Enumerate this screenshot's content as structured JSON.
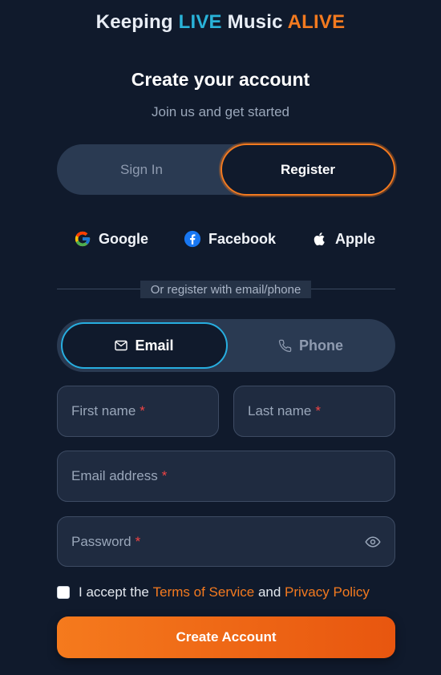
{
  "brand": {
    "part1": "Keeping ",
    "live": "LIVE",
    "part2": " Music ",
    "alive": "ALIVE"
  },
  "header": {
    "title": "Create your account",
    "subtitle": "Join us and get started"
  },
  "auth_toggle": {
    "sign_in": "Sign In",
    "register": "Register",
    "active": "Register"
  },
  "social": {
    "google": "Google",
    "facebook": "Facebook",
    "apple": "Apple"
  },
  "divider": {
    "label": "Or register with email/phone"
  },
  "method_toggle": {
    "email": "Email",
    "phone": "Phone",
    "active": "Email"
  },
  "form": {
    "first_name_placeholder": "First name",
    "last_name_placeholder": "Last name",
    "email_placeholder": "Email address",
    "password_placeholder": "Password",
    "required_marker": "*"
  },
  "terms": {
    "prefix": "I accept the ",
    "tos": "Terms of Service",
    "and": " and ",
    "privacy": "Privacy Policy",
    "checked": false
  },
  "submit": {
    "label": "Create Account"
  },
  "colors": {
    "accent_orange": "#f47a1f",
    "accent_blue": "#29b3d9",
    "background": "#101a2c"
  }
}
